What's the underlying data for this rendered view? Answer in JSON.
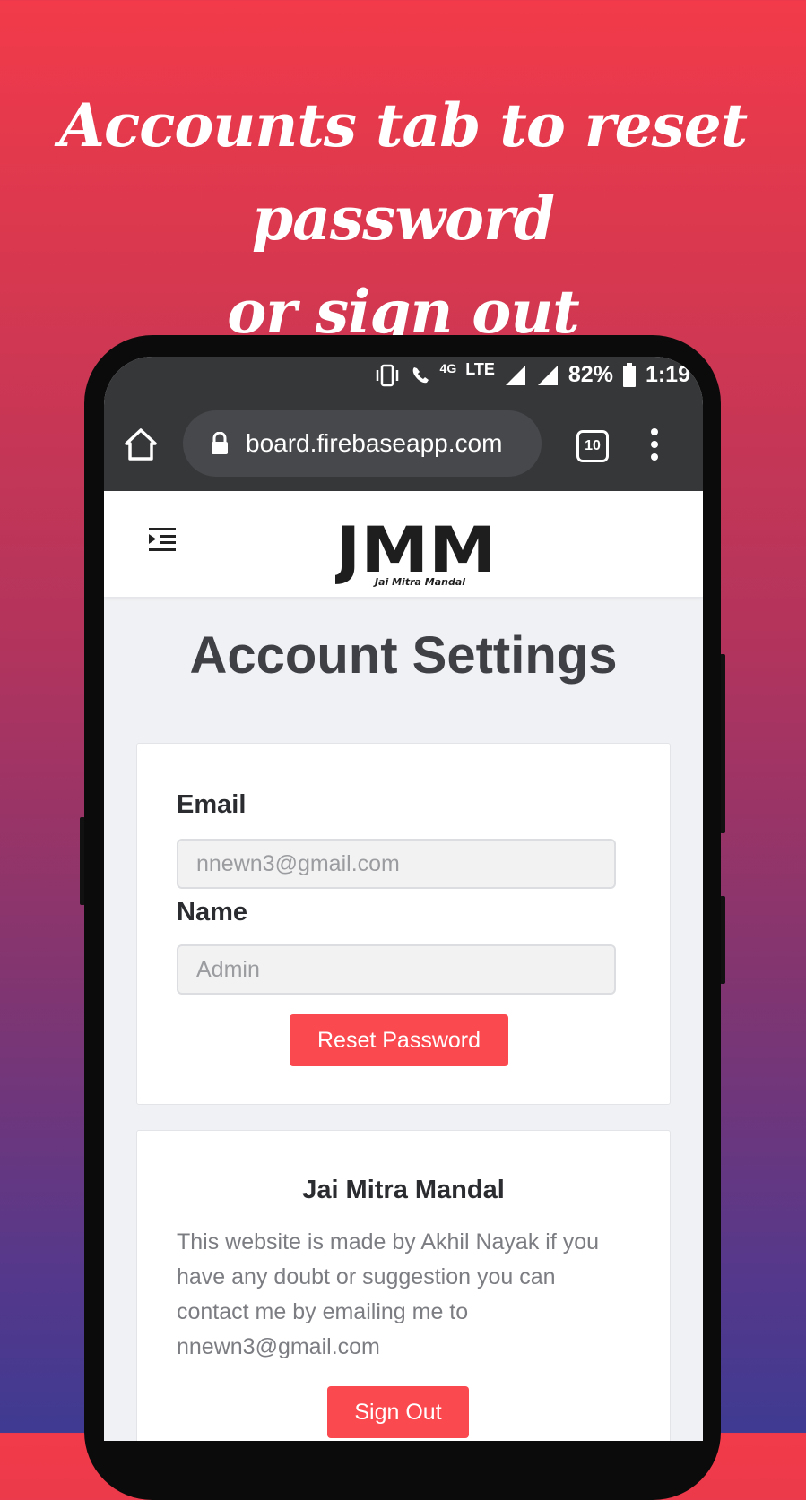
{
  "headline": {
    "line1": "Accounts tab to reset password",
    "line2": "or sign out"
  },
  "status_bar": {
    "network": "4G",
    "lte": "LTE",
    "battery": "82%",
    "time": "1:19"
  },
  "browser": {
    "url": "board.firebaseapp.com",
    "tab_count": "10"
  },
  "site": {
    "logo_text": "JMM",
    "logo_subtitle": "Jai  Mitra  Mandal"
  },
  "page": {
    "title": "Account Settings"
  },
  "account_form": {
    "email_label": "Email",
    "email_placeholder": "nnewn3@gmail.com",
    "name_label": "Name",
    "name_placeholder": "Admin",
    "reset_button": "Reset Password"
  },
  "about_card": {
    "title": "Jai Mitra Mandal",
    "text": "This website is made by Akhil Nayak if you have any doubt or suggestion you can contact me by emailing me to nnewn3@gmail.com",
    "sign_out_button": "Sign Out"
  },
  "colors": {
    "accent": "#fa4a4f",
    "browser_chrome": "#363739",
    "page_bg": "#f0f1f4",
    "title_text": "#3f4046"
  }
}
